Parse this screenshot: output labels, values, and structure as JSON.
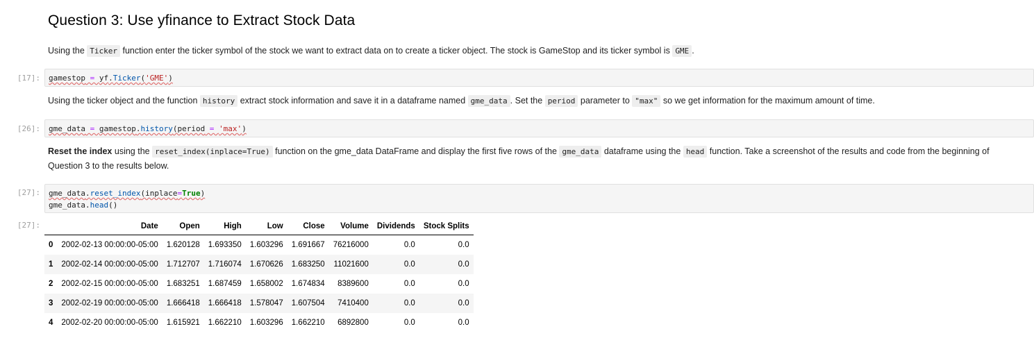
{
  "heading": "Question 3: Use yfinance to Extract Stock Data",
  "md1": {
    "t1": "Using the ",
    "c1": "Ticker",
    "t2": " function enter the ticker symbol of the stock we want to extract data on to create a ticker object. The stock is GameStop and its ticker symbol is ",
    "c2": "GME",
    "t3": "."
  },
  "cell17": {
    "prompt": "[17]:",
    "p1": "gamestop",
    "p2": " = ",
    "p3": "yf",
    "p4": ".",
    "p5": "Ticker",
    "p6": "(",
    "p7": "'GME'",
    "p8": ")"
  },
  "md2": {
    "t1": "Using the ticker object and the function ",
    "c1": "history",
    "t2": " extract stock information and save it in a dataframe named ",
    "c2": "gme_data",
    "t3": ". Set the ",
    "c3": "period",
    "t4": " parameter to ",
    "c4": "\"max\"",
    "t5": " so we get information for the maximum amount of time."
  },
  "cell26": {
    "prompt": "[26]:",
    "p1": "gme_data",
    "p2": " = ",
    "p3": "gamestop",
    "p4": ".",
    "p5": "history",
    "p6": "(period",
    "p7": " = ",
    "p8": "'max'",
    "p9": ")"
  },
  "md3": {
    "b1": "Reset the index",
    "t1": " using the ",
    "c1": "reset_index(inplace=True)",
    "t2": " function on the gme_data DataFrame and display the first five rows of the ",
    "c2": "gme_data",
    "t3": " dataframe using the ",
    "c3": "head",
    "t4": " function. Take a screenshot of the results and code from the beginning of Question 3 to the results below."
  },
  "cell27": {
    "prompt": "[27]:",
    "l1a": "gme_data",
    "l1b": ".",
    "l1c": "reset_index",
    "l1d": "(inplace",
    "l1e": "=",
    "l1f": "True",
    "l1g": ")",
    "l2a": "gme_data",
    "l2b": ".",
    "l2c": "head",
    "l2d": "()"
  },
  "out27": {
    "prompt": "[27]:",
    "columns": [
      "",
      "Date",
      "Open",
      "High",
      "Low",
      "Close",
      "Volume",
      "Dividends",
      "Stock Splits"
    ],
    "rows": [
      [
        "0",
        "2002-02-13 00:00:00-05:00",
        "1.620128",
        "1.693350",
        "1.603296",
        "1.691667",
        "76216000",
        "0.0",
        "0.0"
      ],
      [
        "1",
        "2002-02-14 00:00:00-05:00",
        "1.712707",
        "1.716074",
        "1.670626",
        "1.683250",
        "11021600",
        "0.0",
        "0.0"
      ],
      [
        "2",
        "2002-02-15 00:00:00-05:00",
        "1.683251",
        "1.687459",
        "1.658002",
        "1.674834",
        "8389600",
        "0.0",
        "0.0"
      ],
      [
        "3",
        "2002-02-19 00:00:00-05:00",
        "1.666418",
        "1.666418",
        "1.578047",
        "1.607504",
        "7410400",
        "0.0",
        "0.0"
      ],
      [
        "4",
        "2002-02-20 00:00:00-05:00",
        "1.615921",
        "1.662210",
        "1.603296",
        "1.662210",
        "6892800",
        "0.0",
        "0.0"
      ]
    ]
  }
}
